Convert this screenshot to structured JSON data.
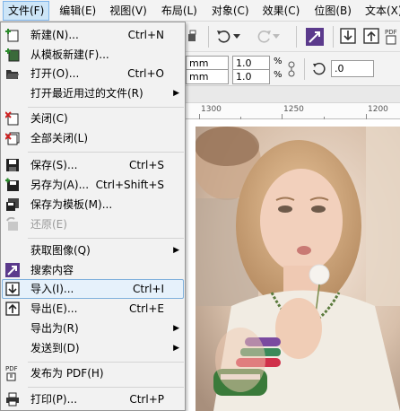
{
  "menubar": {
    "items": [
      {
        "label": "文件(F)"
      },
      {
        "label": "编辑(E)"
      },
      {
        "label": "视图(V)"
      },
      {
        "label": "布局(L)"
      },
      {
        "label": "对象(C)"
      },
      {
        "label": "效果(C)"
      },
      {
        "label": "位图(B)"
      },
      {
        "label": "文本(X)"
      }
    ]
  },
  "toolbar": {
    "field_w": "mm",
    "field_h": "mm",
    "scale_x": "1.0",
    "scale_y": "1.0",
    "pct_symbol": "%",
    "rotation": ".0"
  },
  "ruler": {
    "labels": [
      "1300",
      "1250",
      "1200"
    ]
  },
  "file_menu": {
    "items": [
      {
        "label": "新建(N)...",
        "shortcut": "Ctrl+N",
        "icon": "new-document-icon",
        "enabled": true
      },
      {
        "label": "从模板新建(F)...",
        "shortcut": "",
        "icon": "new-from-template-icon",
        "enabled": true
      },
      {
        "label": "打开(O)...",
        "shortcut": "Ctrl+O",
        "icon": "open-folder-icon",
        "enabled": true
      },
      {
        "label": "打开最近用过的文件(R)",
        "shortcut": "",
        "icon": "",
        "enabled": true,
        "submenu": true
      },
      {
        "label": "关闭(C)",
        "shortcut": "",
        "icon": "close-document-icon",
        "enabled": true
      },
      {
        "label": "全部关闭(L)",
        "shortcut": "",
        "icon": "close-all-icon",
        "enabled": true
      },
      {
        "label": "保存(S)...",
        "shortcut": "Ctrl+S",
        "icon": "save-icon",
        "enabled": true
      },
      {
        "label": "另存为(A)...",
        "shortcut": "Ctrl+Shift+S",
        "icon": "save-as-icon",
        "enabled": true
      },
      {
        "label": "保存为模板(M)...",
        "shortcut": "",
        "icon": "save-as-template-icon",
        "enabled": true
      },
      {
        "label": "还原(E)",
        "shortcut": "",
        "icon": "revert-icon",
        "enabled": false
      },
      {
        "label": "获取图像(Q)",
        "shortcut": "",
        "icon": "",
        "enabled": true,
        "submenu": true
      },
      {
        "label": "搜索内容",
        "shortcut": "",
        "icon": "search-content-icon",
        "enabled": true
      },
      {
        "label": "导入(I)...",
        "shortcut": "Ctrl+I",
        "icon": "import-icon",
        "enabled": true
      },
      {
        "label": "导出(E)...",
        "shortcut": "Ctrl+E",
        "icon": "export-icon",
        "enabled": true
      },
      {
        "label": "导出为(R)",
        "shortcut": "",
        "icon": "",
        "enabled": true,
        "submenu": true
      },
      {
        "label": "发送到(D)",
        "shortcut": "",
        "icon": "",
        "enabled": true,
        "submenu": true
      },
      {
        "label": "发布为 PDF(H)",
        "shortcut": "",
        "icon": "pdf-icon",
        "enabled": true
      },
      {
        "label": "打印(P)...",
        "shortcut": "Ctrl+P",
        "icon": "print-icon",
        "enabled": true
      }
    ],
    "pdf_icon_text": "PDF"
  },
  "colors": {
    "accent": "#7eb4ea",
    "highlight_bg": "#e6f1fb",
    "purple_icon": "#5b3a8c"
  }
}
